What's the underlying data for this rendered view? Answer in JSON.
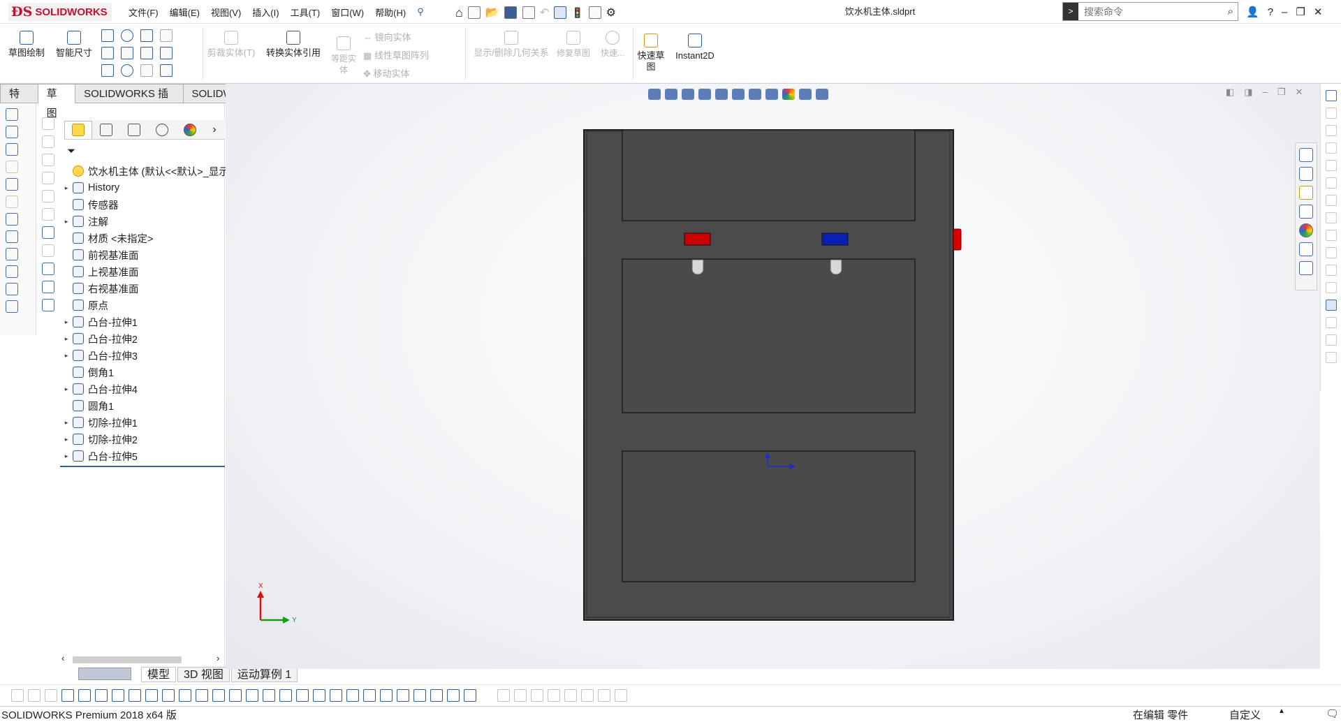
{
  "app": {
    "logo_text": "SOLIDWORKS",
    "doc_title": "饮水机主体.sldprt"
  },
  "menu": [
    "文件(F)",
    "编辑(E)",
    "视图(V)",
    "插入(I)",
    "工具(T)",
    "窗口(W)",
    "帮助(H)"
  ],
  "search": {
    "placeholder": "搜索命令"
  },
  "ribbon": {
    "sketch": "草图绘制",
    "smart_dim": "智能尺寸",
    "trim": "剪裁实体(T)",
    "convert": "转换实体引用",
    "offset": "等距实体",
    "mirror": "镜向实体",
    "linear_pattern": "线性草图阵列",
    "move": "移动实体",
    "relations": "显示/删除几何关系",
    "repair": "修复草图",
    "quick_snap": "快速...",
    "rapid_sketch": "快速草图",
    "instant2d": "Instant2D"
  },
  "command_tabs": [
    "特征",
    "草图",
    "SOLIDWORKS 插件",
    "SOLIDWORKS MBD"
  ],
  "tree": {
    "root": "饮水机主体 (默认<<默认>_显示",
    "items": [
      {
        "label": "History",
        "arrow": true
      },
      {
        "label": "传感器",
        "arrow": false
      },
      {
        "label": "注解",
        "arrow": true
      },
      {
        "label": "材质 <未指定>",
        "arrow": false
      },
      {
        "label": "前视基准面",
        "arrow": false
      },
      {
        "label": "上视基准面",
        "arrow": false
      },
      {
        "label": "右视基准面",
        "arrow": false
      },
      {
        "label": "原点",
        "arrow": false
      },
      {
        "label": "凸台-拉伸1",
        "arrow": true
      },
      {
        "label": "凸台-拉伸2",
        "arrow": true
      },
      {
        "label": "凸台-拉伸3",
        "arrow": true
      },
      {
        "label": "倒角1",
        "arrow": false
      },
      {
        "label": "凸台-拉伸4",
        "arrow": true
      },
      {
        "label": "圆角1",
        "arrow": false
      },
      {
        "label": "切除-拉伸1",
        "arrow": true
      },
      {
        "label": "切除-拉伸2",
        "arrow": true
      },
      {
        "label": "凸台-拉伸5",
        "arrow": true
      }
    ]
  },
  "bottom_tabs": [
    "模型",
    "3D 视图",
    "运动算例 1"
  ],
  "triad": {
    "x": "X",
    "y": "Y"
  },
  "status": {
    "left": "SOLIDWORKS Premium 2018 x64 版",
    "mode": "在编辑 零件",
    "custom": "自定义"
  },
  "colors": {
    "body": "#4b4b4b",
    "hot_button": "#cc0000",
    "cold_button": "#0a1fb5",
    "accent": "#2e5fa8",
    "brand": "#c8102e"
  }
}
